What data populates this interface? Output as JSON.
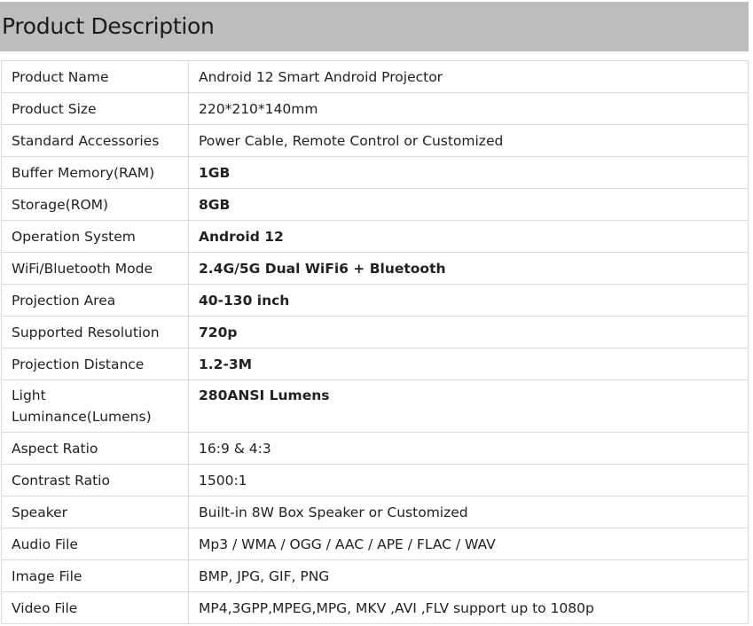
{
  "header": {
    "title": "Product Description"
  },
  "rows": [
    {
      "label": "Product Name",
      "value": "Android 12 Smart Android Projector",
      "bold": false
    },
    {
      "label": "Product Size",
      "value": "220*210*140mm",
      "bold": false
    },
    {
      "label": "Standard Accessories",
      "value": "Power Cable, Remote Control or Customized",
      "bold": false
    },
    {
      "label": "Buffer Memory(RAM)",
      "value": "1GB",
      "bold": true
    },
    {
      "label": "Storage(ROM)",
      "value": "8GB",
      "bold": true
    },
    {
      "label": "Operation System",
      "value": "Android 12",
      "bold": true
    },
    {
      "label": "WiFi/Bluetooth Mode",
      "value": "2.4G/5G Dual WiFi6 + Bluetooth",
      "bold": true
    },
    {
      "label": "Projection Area",
      "value": "40-130 inch",
      "bold": true
    },
    {
      "label": "Supported Resolution",
      "value": "720p",
      "bold": true
    },
    {
      "label": "Projection Distance",
      "value": "1.2-3M",
      "bold": true
    },
    {
      "label": "Light Luminance(Lumens)",
      "value": "280ANSI Lumens",
      "bold": true
    },
    {
      "label": "Aspect Ratio",
      "value": "16:9 & 4:3",
      "bold": false
    },
    {
      "label": "Contrast Ratio",
      "value": "1500:1",
      "bold": false
    },
    {
      "label": "Speaker",
      "value": "Built-in 8W Box Speaker or Customized",
      "bold": false
    },
    {
      "label": "Audio File",
      "value": "Mp3 / WMA / OGG / AAC / APE / FLAC / WAV",
      "bold": false
    },
    {
      "label": "Image File",
      "value": "BMP, JPG, GIF, PNG",
      "bold": false
    },
    {
      "label": "Video File",
      "value": "MP4,3GPP,MPEG,MPG, MKV ,AVI ,FLV support up to 1080p",
      "bold": false
    }
  ]
}
